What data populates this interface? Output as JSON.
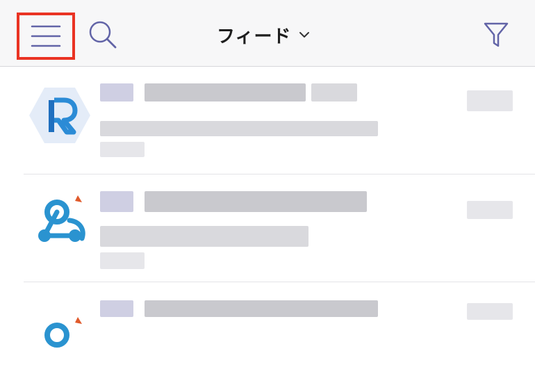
{
  "header": {
    "title": "フィード",
    "icons": {
      "menu": "hamburger-menu-icon",
      "search": "search-icon",
      "dropdown": "chevron-down-icon",
      "filter": "filter-icon"
    },
    "highlight_color": "#ea3323",
    "accent_color": "#6264a7"
  },
  "feed": {
    "items": [
      {
        "avatar": "app-logo-r-icon"
      },
      {
        "avatar": "webhook-icon"
      },
      {
        "avatar": "webhook-icon"
      }
    ]
  }
}
